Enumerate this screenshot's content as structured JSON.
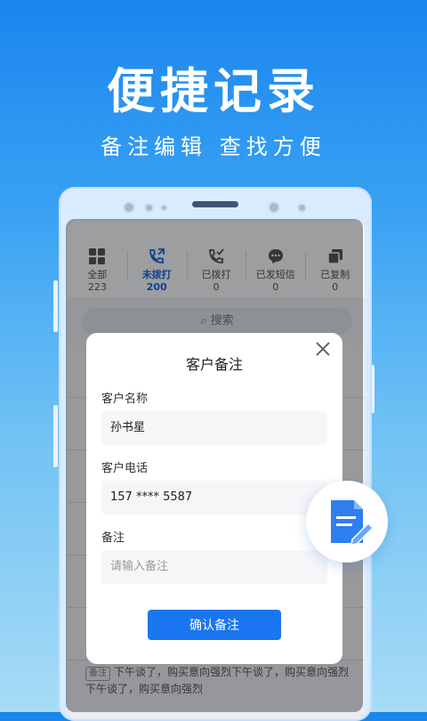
{
  "hero": {
    "title": "便捷记录",
    "subtitle": "备注编辑 查找方便"
  },
  "tabs": [
    {
      "label": "全部",
      "count": "223",
      "icon": "grid-icon"
    },
    {
      "label": "未拨打",
      "count": "200",
      "icon": "phone-outgoing-icon",
      "active": true
    },
    {
      "label": "已拨打",
      "count": "0",
      "icon": "phone-check-icon"
    },
    {
      "label": "已发短信",
      "count": "0",
      "icon": "sms-icon"
    },
    {
      "label": "已复制",
      "count": "0",
      "icon": "copy-icon"
    }
  ],
  "search": {
    "placeholder": "搜索"
  },
  "background_note": {
    "tag": "备注",
    "text": "下午谈了，购买意向强烈下午谈了，购买意向强烈下午谈了，购买意向强烈"
  },
  "dialog": {
    "title": "客户备注",
    "name_label": "客户名称",
    "name_value": "孙书星",
    "phone_label": "客户电话",
    "phone_value": "157 **** 5587",
    "note_label": "备注",
    "note_placeholder": "请输入备注",
    "confirm_label": "确认备注"
  },
  "colors": {
    "accent": "#1a75f0",
    "active_tab": "#1766e0"
  }
}
